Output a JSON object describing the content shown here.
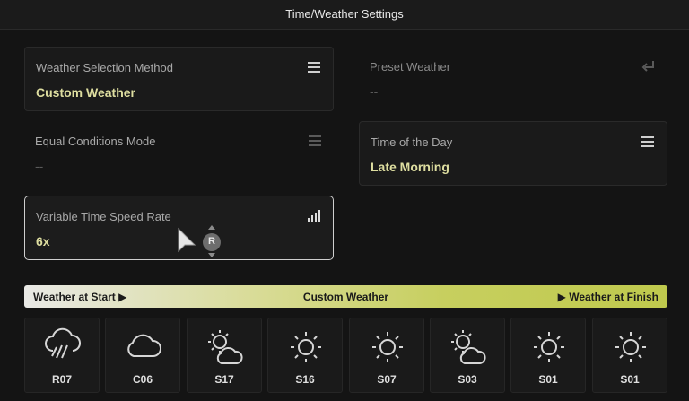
{
  "header": {
    "title": "Time/Weather Settings"
  },
  "settings": {
    "weather_selection": {
      "label": "Weather Selection Method",
      "value": "Custom Weather",
      "icon": "menu-icon"
    },
    "preset_weather": {
      "label": "Preset Weather",
      "value": "--",
      "icon": "return-icon"
    },
    "equal_conditions": {
      "label": "Equal Conditions Mode",
      "value": "--",
      "icon": "menu-icon"
    },
    "time_of_day": {
      "label": "Time of the Day",
      "value": "Late Morning",
      "icon": "menu-icon"
    },
    "variable_time": {
      "label": "Variable Time Speed Rate",
      "value": "6x",
      "icon": "signal-bars-icon"
    }
  },
  "controller": {
    "button_label": "R"
  },
  "weather_bar": {
    "start_label": "Weather at Start ▶",
    "title": "Custom Weather",
    "finish_label": "▶ Weather at Finish"
  },
  "slots": [
    {
      "code": "R07",
      "icon": "rain-cloud-icon"
    },
    {
      "code": "C06",
      "icon": "cloud-icon"
    },
    {
      "code": "S17",
      "icon": "sun-cloud-icon"
    },
    {
      "code": "S16",
      "icon": "sun-icon"
    },
    {
      "code": "S07",
      "icon": "sun-icon"
    },
    {
      "code": "S03",
      "icon": "sun-cloud-icon"
    },
    {
      "code": "S01",
      "icon": "sun-icon"
    },
    {
      "code": "S01",
      "icon": "sun-icon"
    }
  ],
  "colors": {
    "value_text": "#dedea0",
    "bar_start": "#e9e9e6",
    "bar_end": "#bfc94d"
  }
}
